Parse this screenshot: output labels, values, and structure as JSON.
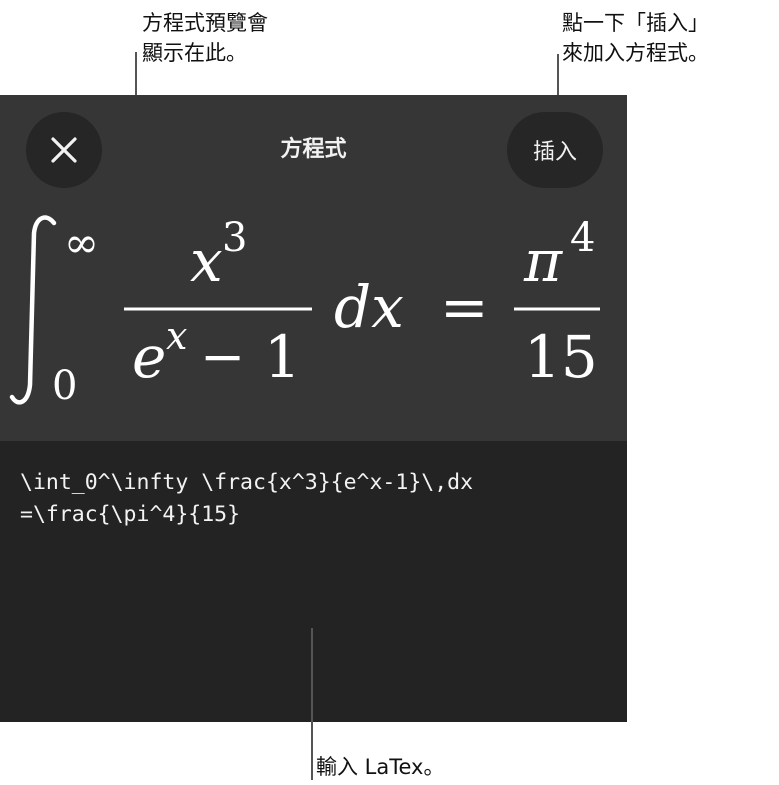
{
  "callouts": {
    "preview": "方程式預覽會\n顯示在此。",
    "insert": "點一下「插入」\n來加入方程式。",
    "latex": "輸入 LaTex。"
  },
  "dialog": {
    "title": "方程式",
    "insert_label": "插入",
    "close_icon": "close-icon"
  },
  "equation": {
    "sup": "∞",
    "sub": "0",
    "num_base": "x",
    "num_exp": "3",
    "den_base": "e",
    "den_exp": "x",
    "den_minus": "−",
    "den_one": "1",
    "dx": "dx",
    "equals": "=",
    "rhs_base": "π",
    "rhs_exp": "4",
    "rhs_den": "15"
  },
  "latex_source": {
    "line1": "\\int_0^\\infty \\frac{x^3}{e^x-1}\\,dx",
    "line2": "=\\frac{\\pi^4}{15}"
  },
  "colors": {
    "panel_bg": "#232323",
    "header_bg": "#363636",
    "button_bg": "#262626",
    "text": "#f2f2f2"
  }
}
